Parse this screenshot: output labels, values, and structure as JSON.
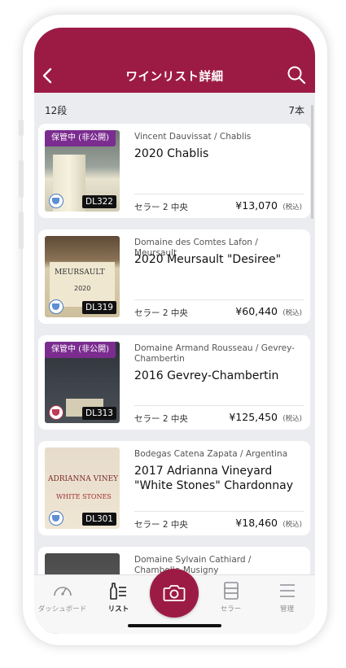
{
  "header": {
    "title": "ワインリスト詳細",
    "back_icon": "chevron-left-icon",
    "search_icon": "search-icon"
  },
  "subbar": {
    "shelf": "12段",
    "count": "7本"
  },
  "wines": [
    {
      "private_badge": "保管中 (非公開)",
      "dl": "DL322",
      "producer": "Vincent Dauvissat / Chablis",
      "name": "2020 Chablis",
      "location": "セラー 2 中央",
      "price": "¥13,070",
      "tax": "(税込)",
      "type_color": "#5d8fd4"
    },
    {
      "private_badge": "",
      "dl": "DL319",
      "producer": "Domaine des Comtes Lafon / Meursault",
      "name": "2020 Meursault \"Desiree\"",
      "location": "セラー 2 中央",
      "price": "¥60,440",
      "tax": "(税込)",
      "type_color": "#5d8fd4"
    },
    {
      "private_badge": "保管中 (非公開)",
      "dl": "DL313",
      "producer": "Domaine Armand Rousseau / Gevrey-Chambertin",
      "name": "2016 Gevrey-Chambertin",
      "location": "セラー 2 中央",
      "price": "¥125,450",
      "tax": "(税込)",
      "type_color": "#c03a54"
    },
    {
      "private_badge": "",
      "dl": "DL301",
      "producer": "Bodegas Catena Zapata / Argentina",
      "name": "2017 Adrianna Vineyard \"White Stones\" Chardonnay",
      "location": "セラー 2 中央",
      "price": "¥18,460",
      "tax": "(税込)",
      "type_color": "#5d8fd4"
    },
    {
      "private_badge": "",
      "dl": "",
      "producer": "Domaine Sylvain Cathiard / Chambolle-Musigny",
      "name": "",
      "location": "",
      "price": "",
      "tax": "",
      "type_color": ""
    }
  ],
  "tabs": [
    {
      "label": "ダッシュボード",
      "icon": "gauge-icon",
      "active": false
    },
    {
      "label": "リスト",
      "icon": "wine-list-icon",
      "active": true
    },
    {
      "label": "",
      "icon": "camera-icon",
      "active": false
    },
    {
      "label": "セラー",
      "icon": "cellar-icon",
      "active": false
    },
    {
      "label": "管理",
      "icon": "menu-icon",
      "active": false
    }
  ],
  "colors": {
    "brand": "#9c1b45",
    "private_badge": "#7b2c8f",
    "background": "#ebecef"
  }
}
